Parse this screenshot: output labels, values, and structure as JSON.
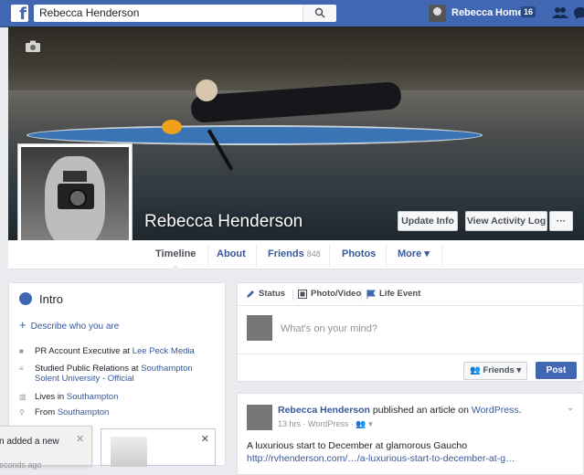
{
  "topbar": {
    "logo": "f",
    "search_value": "Rebecca Henderson",
    "user_name": "Rebecca",
    "home_label": "Home",
    "home_count": "16"
  },
  "profile": {
    "name": "Rebecca Henderson",
    "update_info": "Update Info",
    "view_activity_log": "View Activity Log",
    "more_dots": "···"
  },
  "tabs": {
    "timeline": "Timeline",
    "about": "About",
    "friends": "Friends",
    "friends_count": "848",
    "photos": "Photos",
    "more": "More ▾"
  },
  "intro": {
    "title": "Intro",
    "describe": "Describe who you are",
    "items": [
      {
        "prefix": "PR Account Executive at ",
        "link": "Lee Peck Media"
      },
      {
        "prefix": "Studied Public Relations at ",
        "link": "Southampton Solent University - Official"
      },
      {
        "prefix": "Lives in ",
        "link": "Southampton"
      },
      {
        "prefix": "From ",
        "link": "Southampton"
      }
    ]
  },
  "composer": {
    "status": "Status",
    "photo_video": "Photo/Video",
    "life_event": "Life Event",
    "placeholder": "What's on your mind?",
    "audience": "Friends ▾",
    "post": "Post"
  },
  "story": {
    "author": "Rebecca Henderson",
    "action": " published an article on ",
    "platform": "WordPress",
    "meta": "13 hrs · WordPress · ",
    "text": "A luxurious start to December at glamorous Gaucho",
    "link": "http://rvhenderson.com/…/a-luxurious-start-to-december-at-g…"
  },
  "toast": {
    "line1": "n added a new",
    "line2": "econds ago"
  },
  "colors": {
    "brand": "#4267b2",
    "link": "#365899",
    "background": "#e9ebee"
  }
}
